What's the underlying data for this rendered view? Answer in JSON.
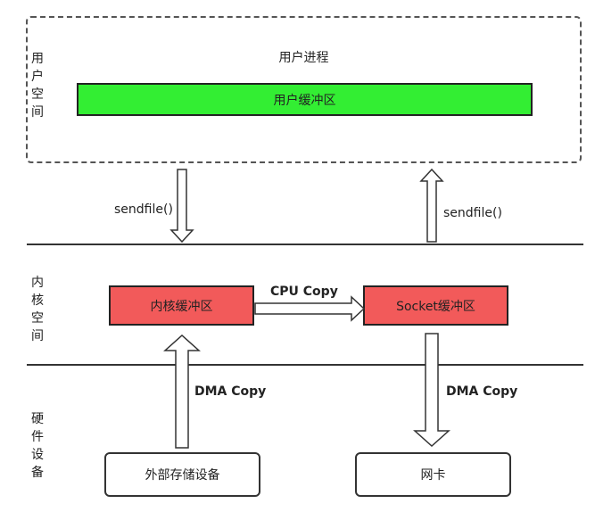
{
  "layers": {
    "user_space": [
      "用",
      "户",
      "空",
      "间"
    ],
    "kernel_space": [
      "内",
      "核",
      "空",
      "间"
    ],
    "hardware": [
      "硬",
      "件",
      "设",
      "备"
    ]
  },
  "user_process": {
    "title": "用户进程",
    "buffer": "用户缓冲区"
  },
  "kernel": {
    "kernel_buffer": "内核缓冲区",
    "socket_buffer": "Socket缓冲区",
    "cpu_copy": "CPU Copy"
  },
  "hardware": {
    "storage": "外部存储设备",
    "nic": "网卡"
  },
  "arrows": {
    "sendfile_down": "sendfile()",
    "sendfile_up": "sendfile()",
    "dma_copy_in": "DMA Copy",
    "dma_copy_out": "DMA Copy"
  },
  "colors": {
    "user_buffer": "#33ee33",
    "kernel_buffers": "#f25a5a"
  }
}
